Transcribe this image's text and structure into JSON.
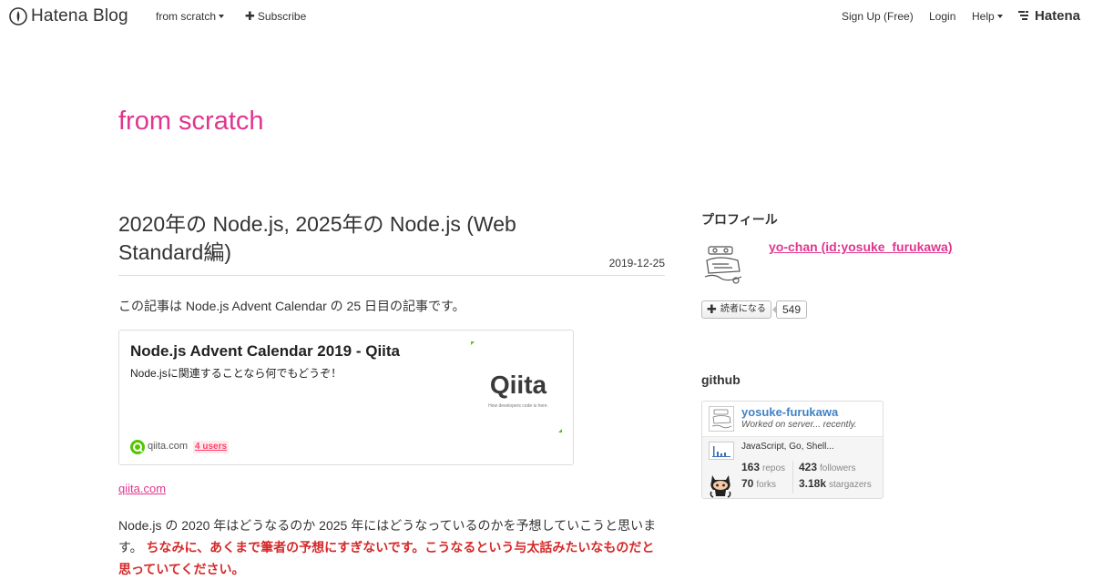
{
  "global_header": {
    "logo_text": "Hatena Blog",
    "blog_menu_label": "from scratch",
    "subscribe_label": "Subscribe",
    "signup_label": "Sign Up (Free)",
    "login_label": "Login",
    "help_label": "Help",
    "hatena_label": "Hatena"
  },
  "blog": {
    "title": "from scratch"
  },
  "entry": {
    "title": "2020年の Node.js, 2025年の Node.js (Web Standard編)",
    "date": "2019-12-25",
    "intro": "この記事は Node.js Advent Calendar の 25 日目の記事です。",
    "embed": {
      "title": "Node.js Advent Calendar 2019 - Qiita",
      "description": "Node.jsに関連することなら何でもどうぞ！",
      "thumb_logo": "Qiita",
      "thumb_tagline": "How developers code is here.",
      "site": "qiita.com",
      "users": "4 users"
    },
    "cite_link": "qiita.com",
    "paragraph_plain": "Node.js の 2020 年はどうなるのか 2025 年にはどうなっているのかを予想していこうと思います。 ",
    "paragraph_strong": "ちなみに、あくまで筆者の予想にすぎないです。こうなるという与太話みたいなものだと思っていてください。"
  },
  "sidebar": {
    "profile": {
      "heading": "プロフィール",
      "name": "yo-chan (id:yosuke_furukawa)",
      "subscribe_button": "読者になる",
      "subscriber_count": "549"
    },
    "github": {
      "heading": "github",
      "username": "yosuke-furukawa",
      "bio": "Worked on server... recently.",
      "languages": "JavaScript, Go, Shell...",
      "repos_value": "163",
      "repos_label": "repos",
      "forks_value": "70",
      "forks_label": "forks",
      "followers_value": "423",
      "followers_label": "followers",
      "stargazers_value": "3.18k",
      "stargazers_label": "stargazers"
    }
  },
  "colors": {
    "accent": "#e0368e",
    "emphasis": "#d52a2a",
    "link_blue": "#4183c4",
    "qiita_green": "#55c500"
  },
  "icons": [
    "hatena-blog-logo-icon",
    "caret-down-icon",
    "plus-icon",
    "hatena-mark-icon",
    "qiita-icon",
    "octocat-icon",
    "language-chart-icon"
  ]
}
